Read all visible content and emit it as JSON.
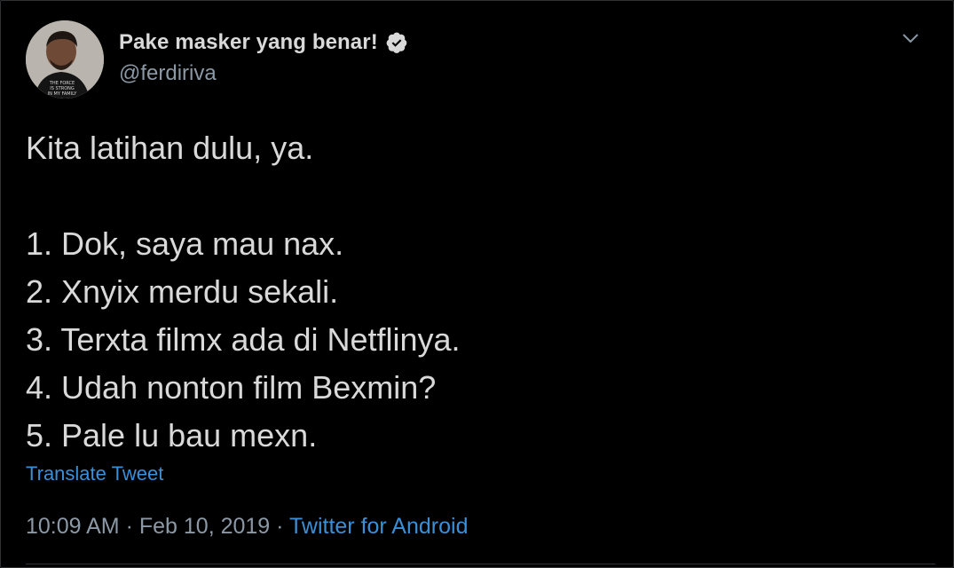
{
  "tweet": {
    "author": {
      "display_name": "Pake masker yang benar!",
      "handle": "@ferdiriva",
      "verified": true,
      "avatar_icon": "profile-photo",
      "avatar_shirt_text": "THE FORCE IS STRONG IN MY FAMILY"
    },
    "menu_icon": "chevron-down-icon",
    "text_lines": [
      "Kita latihan dulu, ya.",
      "",
      "1. Dok, saya mau nax.",
      "2. Xnyix merdu sekali.",
      "3. Terxta filmx ada di Netflinya.",
      "4. Udah nonton film Bexmin?",
      "5. Pale lu bau mexn."
    ],
    "translate_label": "Translate Tweet",
    "time": "10:09 AM",
    "separator": "·",
    "date": "Feb 10, 2019",
    "source": "Twitter for Android"
  },
  "colors": {
    "background": "#000000",
    "text": "#d9d9d9",
    "muted": "#8b98a5",
    "link": "#3a8fd6"
  }
}
